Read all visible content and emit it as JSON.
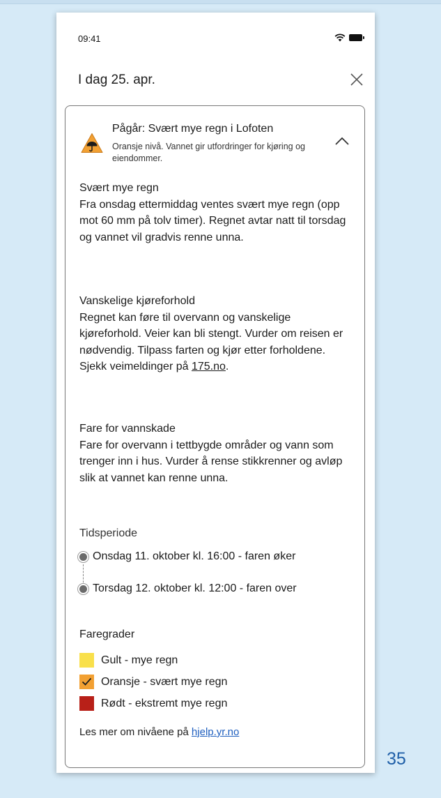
{
  "status_bar": {
    "time": "09:41",
    "icons": [
      "wifi-icon",
      "battery-icon"
    ]
  },
  "header": {
    "title": "I dag 25. apr.",
    "close_icon": "close-icon"
  },
  "alert": {
    "icon": "orange-warning-umbrella-icon",
    "title": "Pågår: Svært mye regn i Lofoten",
    "subtitle": "Oransje nivå. Vannet gir utfordringer for kjøring og eiendommer.",
    "toggle_icon": "chevron-up-icon"
  },
  "sections": [
    {
      "heading": "Svært mye regn",
      "body": "Fra onsdag ettermiddag ventes svært mye regn (opp mot 60 mm på tolv timer). Regnet avtar natt til torsdag og vannet vil gradvis renne unna."
    },
    {
      "heading": "Vanskelige kjøreforhold",
      "body": "Regnet kan føre til overvann og vanskelige kjøreforhold. Veier kan bli stengt. Vurder om reisen er nødvendig. Tilpass farten og kjør etter forholdene. Sjekk veimeldinger på ",
      "link": "175.no",
      "body_end": "."
    },
    {
      "heading": "Fare for vannskade",
      "body": "Fare for overvann i tettbygde områder og vann som trenger inn i hus. Vurder å rense stikkrenner og avløp slik at vannet kan renne unna."
    }
  ],
  "time_period": {
    "label": "Tidsperiode",
    "start": "Onsdag 11. oktober kl. 16:00 - faren øker",
    "end": "Torsdag 12. oktober kl. 12:00 - faren over"
  },
  "levels": {
    "title": "Faregrader",
    "items": [
      {
        "label": "Gult - mye regn",
        "color": "#f9e04b",
        "checked": false
      },
      {
        "label": "Oransje - svært mye regn",
        "color": "#f2a032",
        "checked": true
      },
      {
        "label": "Rødt - ekstremt mye regn",
        "color": "#b82018",
        "checked": false
      }
    ],
    "more_info_text": "Les mer om nivåene på ",
    "more_info_link": "hjelp.yr.no"
  },
  "page_number": "35"
}
